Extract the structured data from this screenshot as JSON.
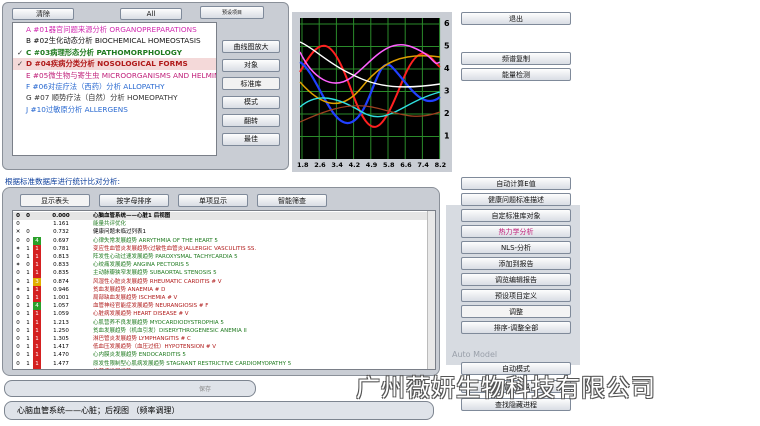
{
  "top_buttons": {
    "clear": "清除",
    "all": "All",
    "preset": "预设项目"
  },
  "categories": [
    {
      "check": "",
      "label": "A #01器官问题来源分析 ORGANOPREPARATIONS",
      "color": "#d12ab0",
      "bold": false
    },
    {
      "check": "",
      "label": "B #02生化动态分析 BIOCHEMICAL HOMEOSTASIS",
      "color": "#111111",
      "bold": false
    },
    {
      "check": "✓",
      "label": "C #03病理形态分析 PATHOMORPHOLOGY",
      "color": "#1f7a1f",
      "bold": true
    },
    {
      "check": "✓",
      "label": "D #04疾病分类分析 NOSOLOGICAL FORMS",
      "color": "#b01a1a",
      "bold": true
    },
    {
      "check": "",
      "label": "E #05微生物与寄生虫 MICROORGANISMS AND HELMIN",
      "color": "#c0207a",
      "bold": false
    },
    {
      "check": "",
      "label": "F #06对症疗法（西药）分析 ALLOPATHY",
      "color": "#2a6ad1",
      "bold": false
    },
    {
      "check": "",
      "label": "G #07 顺势疗法（自然）分析 HOMEOPATHY",
      "color": "#333333",
      "bold": false
    },
    {
      "check": "",
      "label": "J #10过敏原分析 ALLERGENS",
      "color": "#2a6ad1",
      "bold": false
    }
  ],
  "side_buttons": [
    "曲线图放大",
    "对象",
    "标准库",
    "模式",
    "翻转",
    "最佳"
  ],
  "chart": {
    "y_ticks": [
      "6",
      "5",
      "4",
      "3",
      "2",
      "1"
    ],
    "x_ticks": [
      "1.8",
      "2.6",
      "3.4",
      "4.2",
      "4.9",
      "5.8",
      "6.6",
      "7.4",
      "8.2"
    ]
  },
  "right_top": {
    "exit": "退出",
    "freq_copy": "频谱复制",
    "energy_detect": "能量检测"
  },
  "stats_label": "根据标准数据库进行统计比对分析:",
  "table_tabs": [
    "显示表头",
    "按字母排序",
    "单项显示",
    "智能筛查"
  ],
  "table_rows": [
    {
      "a": "0",
      "b": "0",
      "c": "",
      "cc": "",
      "val": "0.000",
      "text": "心脑血管系统——心脏1 后视图",
      "tc": "#000000",
      "hdr": true
    },
    {
      "a": "0",
      "b": "",
      "c": "",
      "cc": "",
      "val": "1.161",
      "text": "能量共评优化",
      "tc": "#1f7a1f"
    },
    {
      "a": "✕",
      "b": "0",
      "c": "",
      "cc": "",
      "val": "0.732",
      "text": "健康问题未临过列表1",
      "tc": "#000000"
    },
    {
      "a": "0",
      "b": "0",
      "c": "4",
      "cc": "#2aa02a",
      "val": "0.697",
      "text": "心律失常发展趋势 ARRYTHMIA OF THE HEART 5",
      "tc": "#1f7a1f"
    },
    {
      "a": "✶",
      "b": "1",
      "c": "1",
      "cc": "#d42020",
      "val": "0.781",
      "text": "变应性血管炎发展趋势(过敏性血管炎)ALLERGIC VASCULITIS SS.",
      "tc": "#b01a1a"
    },
    {
      "a": "0",
      "b": "1",
      "c": "1",
      "cc": "#d42020",
      "val": "0.813",
      "text": "阵发性心动过速发展趋势 PAROXYSMAL TACHYCARDIA 5",
      "tc": "#1f7a1f"
    },
    {
      "a": "✶",
      "b": "0",
      "c": "1",
      "cc": "#d42020",
      "val": "0.833",
      "text": "心绞痛发展趋势 ANGINA PECTORIS 5",
      "tc": "#1f7a1f"
    },
    {
      "a": "0",
      "b": "1",
      "c": "1",
      "cc": "#d42020",
      "val": "0.835",
      "text": "主动脉瓣狭窄发展趋势 SUBAORTAL STENOSIS 5",
      "tc": "#1f7a1f"
    },
    {
      "a": "0",
      "b": "1",
      "c": "3",
      "cc": "#e0b000",
      "val": "0.874",
      "text": "风湿性心脏炎发展趋势 RHEUMATIC CARDITIS # V",
      "tc": "#b01a1a"
    },
    {
      "a": "✶",
      "b": "1",
      "c": "1",
      "cc": "#d42020",
      "val": "0.946",
      "text": "贫血发展趋势 ANAEMIA # D",
      "tc": "#b01a1a"
    },
    {
      "a": "0",
      "b": "1",
      "c": "1",
      "cc": "#d42020",
      "val": "1.001",
      "text": "局部缺血发展趋势 ISCHEMIA # V",
      "tc": "#b01a1a"
    },
    {
      "a": "0",
      "b": "1",
      "c": "4",
      "cc": "#2aa02a",
      "val": "1.057",
      "text": "血管神经官能症发展趋势 NEURANGIOSIS # F",
      "tc": "#b01a1a"
    },
    {
      "a": "0",
      "b": "1",
      "c": "1",
      "cc": "#d42020",
      "val": "1.059",
      "text": "心脏病发展趋势 HEART DISEASE # V",
      "tc": "#b01a1a"
    },
    {
      "a": "0",
      "b": "1",
      "c": "1",
      "cc": "#d42020",
      "val": "1.213",
      "text": "心肌营养不良发展趋势 MYOCARDIODYSTROPHIA 5",
      "tc": "#1f7a1f"
    },
    {
      "a": "0",
      "b": "1",
      "c": "1",
      "cc": "#d42020",
      "val": "1.250",
      "text": "贫血发展趋势（机血引发）DISERYTHROGENESIC ANEMIA II",
      "tc": "#1f7a1f"
    },
    {
      "a": "0",
      "b": "1",
      "c": "1",
      "cc": "#d42020",
      "val": "1.305",
      "text": "淋巴管炎发展趋势 LYMPHANGITIS # C",
      "tc": "#b01a1a"
    },
    {
      "a": "0",
      "b": "1",
      "c": "1",
      "cc": "#d42020",
      "val": "1.417",
      "text": "低血压发展趋势（血压过低）HYPOTENSION # V",
      "tc": "#b01a1a"
    },
    {
      "a": "0",
      "b": "1",
      "c": "1",
      "cc": "#d42020",
      "val": "1.470",
      "text": "心内膜炎发展趋势 ENDOCARDITIS 5",
      "tc": "#1f7a1f"
    },
    {
      "a": "0",
      "b": "1",
      "c": "1",
      "cc": "#d42020",
      "val": "1.477",
      "text": "原发性限制型心肌病发展趋势 STAGNANT RESTRICTIVE CARDIOMYOPATHY 5",
      "tc": "#1f7a1f"
    },
    {
      "a": "0",
      "b": "1",
      "c": "1",
      "cc": "#d42020",
      "val": "1.679",
      "text": "结节病发展趋势 SARCOIDOSIS # C",
      "tc": "#b01a1a"
    }
  ],
  "right_buttons": [
    "自动计算E值",
    "健康问题标准描述",
    "自定标准库对象",
    "热力学分析",
    "NLS-分析",
    "添加到报告",
    "调览编辑报告",
    "预设项目定义",
    "调整",
    "排序-调整全部"
  ],
  "auto_model": "Auto Model",
  "bottom_right_buttons": [
    "自动模式",
    "增加剂量",
    "查找隐藏进程"
  ],
  "status_small": "保存",
  "status_text": "心脑血管系统——心脏；后视图 （频率调理）",
  "watermark": "广州薇妍生物科技有限公司"
}
